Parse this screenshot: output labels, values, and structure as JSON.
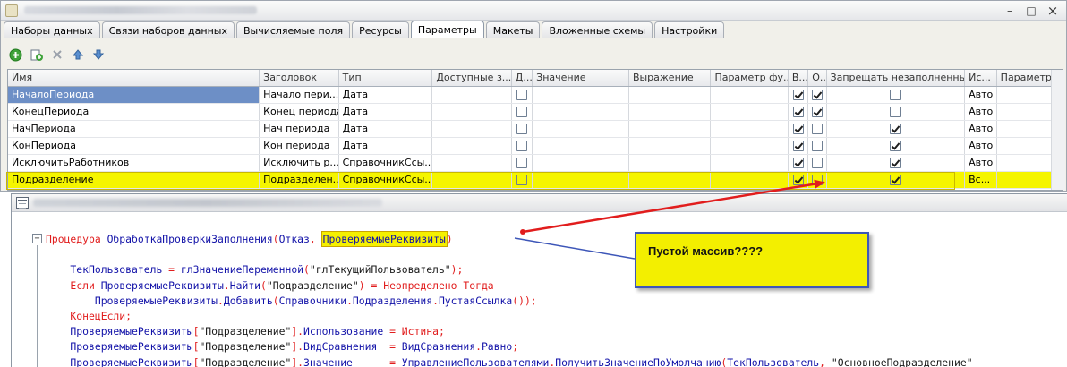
{
  "settings_window": {
    "window_buttons": {
      "minimize": "–",
      "restore": "□",
      "close": "×"
    },
    "tabs": [
      {
        "label": "Наборы данных"
      },
      {
        "label": "Связи наборов данных"
      },
      {
        "label": "Вычисляемые поля"
      },
      {
        "label": "Ресурсы"
      },
      {
        "label": "Параметры",
        "active": true
      },
      {
        "label": "Макеты"
      },
      {
        "label": "Вложенные схемы"
      },
      {
        "label": "Настройки"
      }
    ],
    "toolbar_icons": [
      "add-icon",
      "copy-icon",
      "delete-icon",
      "move-up-icon",
      "move-down-icon"
    ],
    "params_table": {
      "columns": [
        "Имя",
        "Заголовок",
        "Тип",
        "Доступные з...",
        "Д...",
        "Значение",
        "Выражение",
        "Параметр фу...",
        "В...",
        "О...",
        "Запрещать незаполненны...",
        "Ис...",
        "Параметр..."
      ],
      "rows": [
        {
          "name": "НачалоПериода",
          "title": "Начало пери...",
          "type": "Дата",
          "avail": "",
          "d": false,
          "value": "",
          "expr": "",
          "func": "",
          "v": true,
          "o": true,
          "forbid": false,
          "use": "Авто",
          "param": "",
          "selected": true,
          "highlighted": false
        },
        {
          "name": "КонецПериода",
          "title": "Конец периода",
          "type": "Дата",
          "avail": "",
          "d": false,
          "value": "",
          "expr": "",
          "func": "",
          "v": true,
          "o": true,
          "forbid": false,
          "use": "Авто",
          "param": "",
          "selected": false,
          "highlighted": false
        },
        {
          "name": "НачПериода",
          "title": "Нач периода",
          "type": "Дата",
          "avail": "",
          "d": false,
          "value": "",
          "expr": "",
          "func": "",
          "v": true,
          "o": false,
          "forbid": true,
          "use": "Авто",
          "param": "",
          "selected": false,
          "highlighted": false
        },
        {
          "name": "КонПериода",
          "title": "Кон периода",
          "type": "Дата",
          "avail": "",
          "d": false,
          "value": "",
          "expr": "",
          "func": "",
          "v": true,
          "o": false,
          "forbid": true,
          "use": "Авто",
          "param": "",
          "selected": false,
          "highlighted": false
        },
        {
          "name": "ИсключитьРаботников",
          "title": "Исключить р...",
          "type": "СправочникСсы...",
          "avail": "",
          "d": false,
          "value": "",
          "expr": "",
          "func": "",
          "v": true,
          "o": false,
          "forbid": true,
          "use": "Авто",
          "param": "",
          "selected": false,
          "highlighted": false
        },
        {
          "name": "Подразделение",
          "title": "Подразделен...",
          "type": "СправочникСсы...",
          "avail": "",
          "d": false,
          "value": "",
          "expr": "",
          "func": "",
          "v": true,
          "o": false,
          "forbid": true,
          "use": "Вс...",
          "param": "",
          "selected": false,
          "highlighted": true
        }
      ]
    }
  },
  "code_window": {
    "fold_marker": "−",
    "code_lines": [
      {
        "parts": [
          {
            "t": "Процедура ",
            "c": "kw"
          },
          {
            "t": "ОбработкаПроверкиЗаполнения",
            "c": "id"
          },
          {
            "t": "(",
            "c": "sym"
          },
          {
            "t": "Отказ",
            "c": "id"
          },
          {
            "t": ", ",
            "c": "sym"
          },
          {
            "t": "ПроверяемыеРеквизиты",
            "c": "hl"
          },
          {
            "t": ")",
            "c": "sym"
          }
        ]
      },
      {
        "parts": []
      },
      {
        "parts": [
          {
            "t": "    ТекПользователь ",
            "c": "id"
          },
          {
            "t": "= ",
            "c": "sym"
          },
          {
            "t": "глЗначениеПеременной",
            "c": "id"
          },
          {
            "t": "(",
            "c": "sym"
          },
          {
            "t": "\"глТекущийПользователь\"",
            "c": "tx"
          },
          {
            "t": ");",
            "c": "sym"
          }
        ]
      },
      {
        "parts": [
          {
            "t": "    Если ",
            "c": "kw"
          },
          {
            "t": "ПроверяемыеРеквизиты",
            "c": "id"
          },
          {
            "t": ".",
            "c": "sym"
          },
          {
            "t": "Найти",
            "c": "id"
          },
          {
            "t": "(",
            "c": "sym"
          },
          {
            "t": "\"Подразделение\"",
            "c": "tx"
          },
          {
            "t": ") = ",
            "c": "sym"
          },
          {
            "t": "Неопределено Тогда",
            "c": "kw"
          }
        ]
      },
      {
        "parts": [
          {
            "t": "        ПроверяемыеРеквизиты",
            "c": "id"
          },
          {
            "t": ".",
            "c": "sym"
          },
          {
            "t": "Добавить",
            "c": "id"
          },
          {
            "t": "(",
            "c": "sym"
          },
          {
            "t": "Справочники",
            "c": "id"
          },
          {
            "t": ".",
            "c": "sym"
          },
          {
            "t": "Подразделения",
            "c": "id"
          },
          {
            "t": ".",
            "c": "sym"
          },
          {
            "t": "ПустаяСсылка",
            "c": "id"
          },
          {
            "t": "());",
            "c": "sym"
          }
        ]
      },
      {
        "parts": [
          {
            "t": "    КонецЕсли",
            "c": "kw"
          },
          {
            "t": ";",
            "c": "sym"
          }
        ]
      },
      {
        "parts": [
          {
            "t": "    ПроверяемыеРеквизиты",
            "c": "id"
          },
          {
            "t": "[",
            "c": "sym"
          },
          {
            "t": "\"Подразделение\"",
            "c": "tx"
          },
          {
            "t": "].",
            "c": "sym"
          },
          {
            "t": "Использование ",
            "c": "id"
          },
          {
            "t": "= ",
            "c": "sym"
          },
          {
            "t": "Истина",
            "c": "kw"
          },
          {
            "t": ";",
            "c": "sym"
          }
        ]
      },
      {
        "parts": [
          {
            "t": "    ПроверяемыеРеквизиты",
            "c": "id"
          },
          {
            "t": "[",
            "c": "sym"
          },
          {
            "t": "\"Подразделение\"",
            "c": "tx"
          },
          {
            "t": "].",
            "c": "sym"
          },
          {
            "t": "ВидСравнения  ",
            "c": "id"
          },
          {
            "t": "= ",
            "c": "sym"
          },
          {
            "t": "ВидСравнения",
            "c": "id"
          },
          {
            "t": ".",
            "c": "sym"
          },
          {
            "t": "Равно",
            "c": "id"
          },
          {
            "t": ";",
            "c": "sym"
          }
        ]
      },
      {
        "parts": [
          {
            "t": "    ПроверяемыеРеквизиты",
            "c": "id"
          },
          {
            "t": "[",
            "c": "sym"
          },
          {
            "t": "\"Подразделение\"",
            "c": "tx"
          },
          {
            "t": "].",
            "c": "sym"
          },
          {
            "t": "Значение      ",
            "c": "id"
          },
          {
            "t": "= ",
            "c": "sym"
          },
          {
            "t": "УправлениеПользователями",
            "c": "id"
          },
          {
            "t": ".",
            "c": "sym"
          },
          {
            "t": "ПолучитьЗначениеПоУмолчанию",
            "c": "id"
          },
          {
            "t": "(",
            "c": "sym"
          },
          {
            "t": "ТекПользователь",
            "c": "id"
          },
          {
            "t": ", ",
            "c": "sym"
          },
          {
            "t": "\"ОсновноеПодразделение\"",
            "c": "tx"
          }
        ]
      }
    ]
  },
  "annotation": {
    "text": "Пустой массив????",
    "accent": "#e11d1d",
    "callout_fill": "#f3ef00",
    "callout_border": "#3d56b8"
  }
}
